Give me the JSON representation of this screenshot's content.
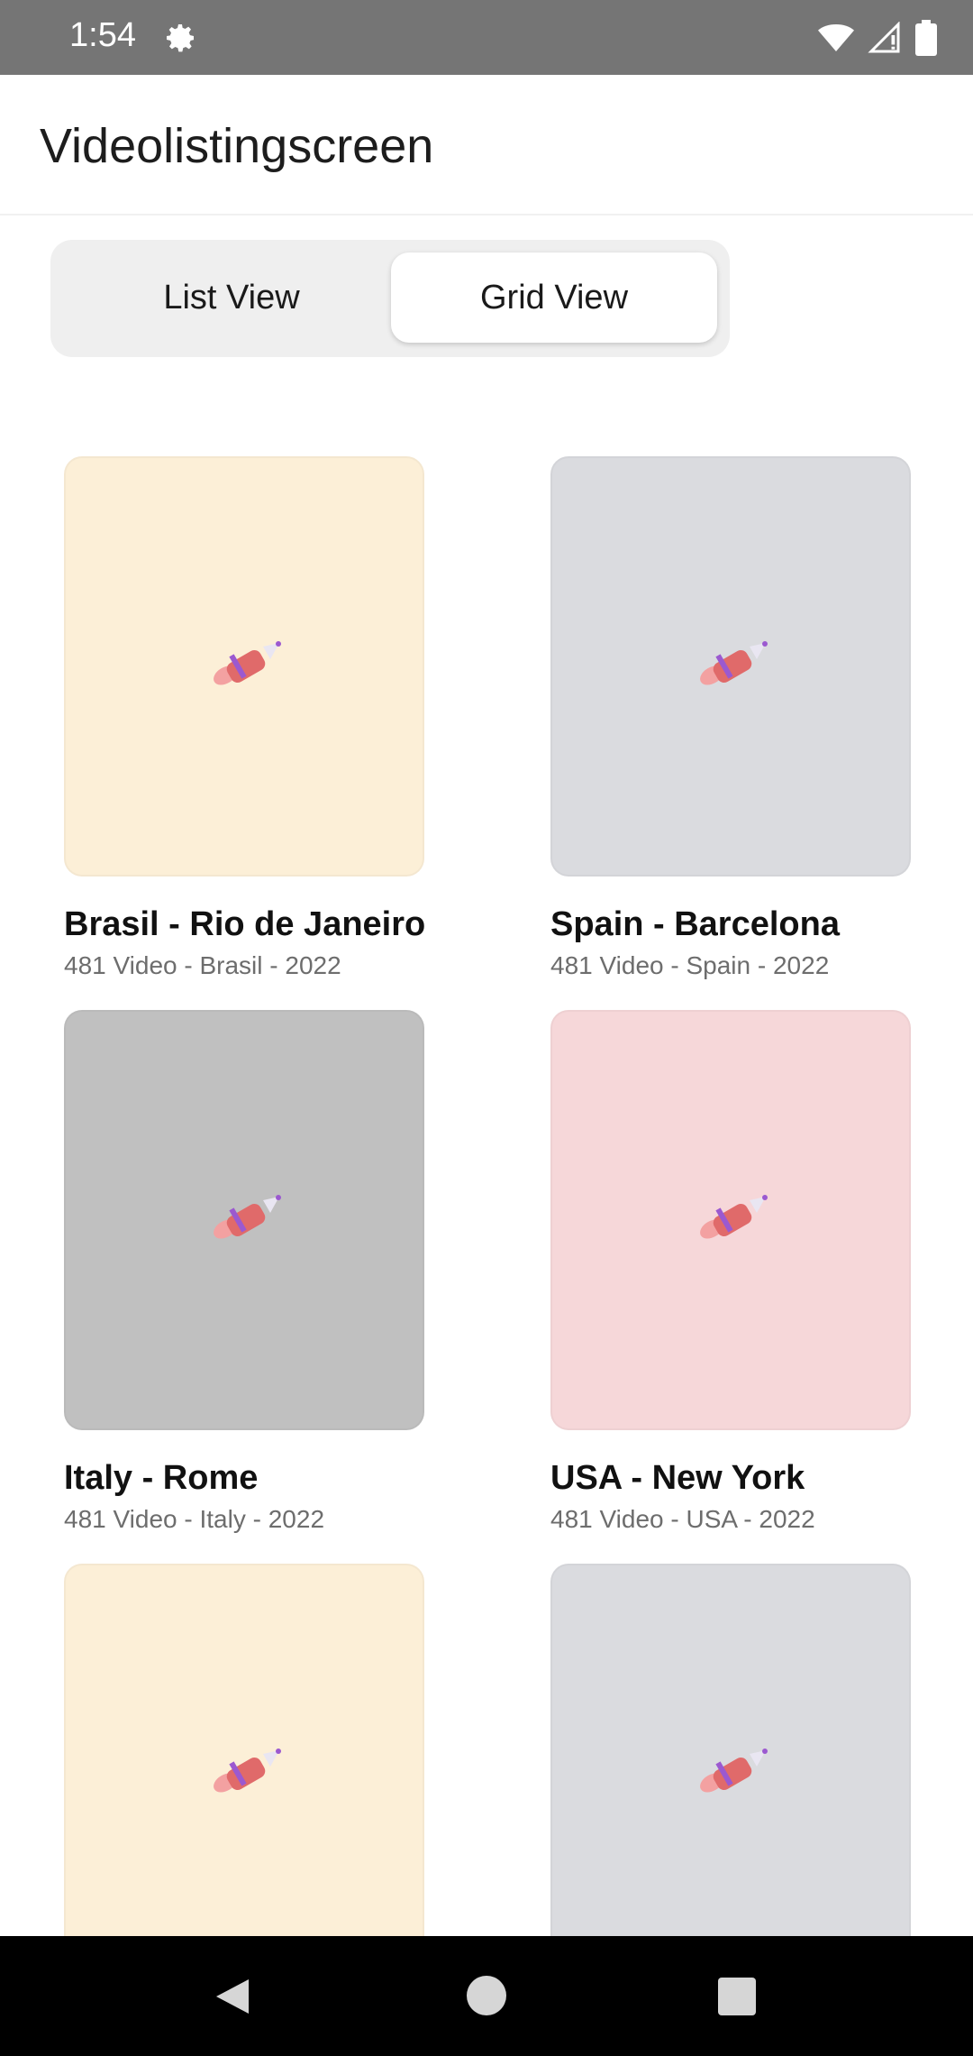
{
  "status_bar": {
    "time": "1:54",
    "icons": [
      "gear-icon",
      "wifi-icon",
      "signal-icon",
      "battery-icon"
    ]
  },
  "app_bar": {
    "title": "Videolistingscreen"
  },
  "view_toggle": {
    "options": [
      {
        "label": "List View",
        "selected": false
      },
      {
        "label": "Grid View",
        "selected": true
      }
    ]
  },
  "videos": [
    {
      "title": "Brasil - Rio de Janeiro",
      "subtitle": "481 Video - Brasil - 2022",
      "color": "#fcefd7",
      "icon": "rocket-icon"
    },
    {
      "title": "Spain - Barcelona",
      "subtitle": "481 Video - Spain - 2022",
      "color": "#dadbdf",
      "icon": "rocket-icon"
    },
    {
      "title": "Italy - Rome",
      "subtitle": "481 Video - Italy - 2022",
      "color": "#c0c0c0",
      "icon": "rocket-icon"
    },
    {
      "title": "USA - New York",
      "subtitle": "481 Video - USA - 2022",
      "color": "#f6d7d9",
      "icon": "rocket-icon"
    },
    {
      "title": "",
      "subtitle": "",
      "color": "#fcefd7",
      "icon": "rocket-icon"
    },
    {
      "title": "",
      "subtitle": "",
      "color": "#dadbdf",
      "icon": "rocket-icon"
    }
  ],
  "nav_bar": {
    "icons": [
      "back-icon",
      "home-icon",
      "recents-icon"
    ]
  }
}
